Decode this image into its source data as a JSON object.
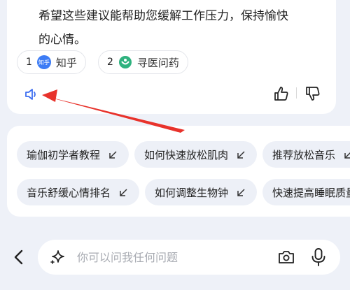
{
  "answer": {
    "lines": [
      "希望这些建议能帮助您缓解工作压力，保持愉快",
      "的心情。"
    ]
  },
  "sources": [
    {
      "index": "1",
      "logo_text": "知乎",
      "name": "知乎"
    },
    {
      "index": "2",
      "name": "寻医问药"
    }
  ],
  "actions": {
    "speaker_icon": "speaker-icon",
    "like_icon": "thumbs-up-icon",
    "dislike_icon": "thumbs-down-icon"
  },
  "suggestions": {
    "row1": [
      "瑜伽初学者教程",
      "如何快速放松肌肉",
      "推荐放松音乐"
    ],
    "row2": [
      "音乐舒缓心情排名",
      "如何调整生物钟",
      "快速提高睡眠质量"
    ]
  },
  "composer": {
    "placeholder": "你可以问我任何问题",
    "back_icon": "chevron-left-icon",
    "sparkle_icon": "sparkle-icon",
    "camera_icon": "camera-icon",
    "mic_icon": "microphone-icon"
  },
  "colors": {
    "accent": "#3d6ef0",
    "annotation_arrow": "#e8322b",
    "background": "#eef1f8"
  }
}
